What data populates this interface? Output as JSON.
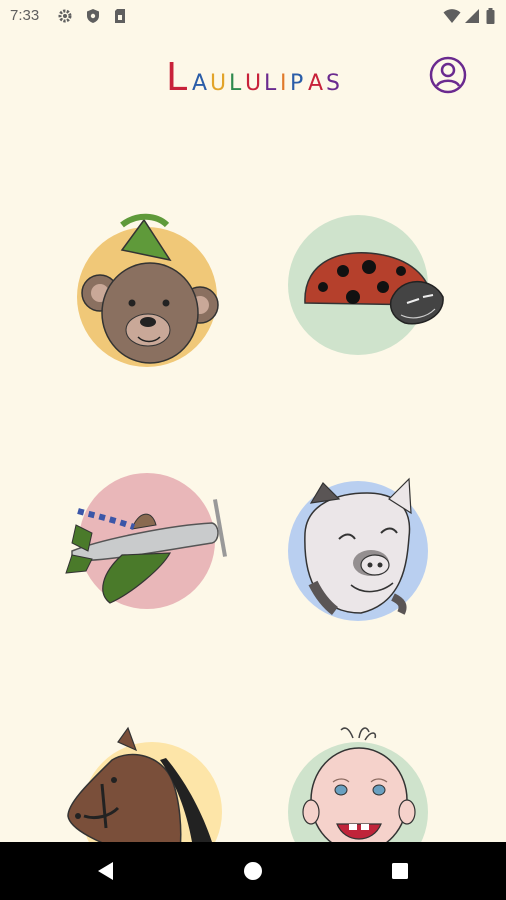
{
  "status_bar": {
    "time": "7:33",
    "left_icons": [
      "gear-icon",
      "shield-icon",
      "sim-card-icon"
    ],
    "right_icons": [
      "wifi-icon",
      "cellular-signal-icon",
      "battery-icon"
    ]
  },
  "app_bar": {
    "logo_letters": [
      "L",
      "A",
      "U",
      "L",
      "U",
      "L",
      "I",
      "P",
      "A",
      "S"
    ],
    "profile_icon": "account-circle-icon",
    "accent_color": "#6a2a8f"
  },
  "song_tiles": [
    {
      "icon": "teddy-bear-party-hat",
      "circle_color": "#f0c878"
    },
    {
      "icon": "ladybug",
      "circle_color": "#cfe3cc"
    },
    {
      "icon": "airplane-with-pilot",
      "circle_color": "#e9b7b9"
    },
    {
      "icon": "pig",
      "circle_color": "#b9cff0"
    },
    {
      "icon": "horse",
      "circle_color": "#fde5a8"
    },
    {
      "icon": "baby",
      "circle_color": "#cfe3cc"
    }
  ],
  "nav_bar": {
    "buttons": [
      "back-icon",
      "home-icon",
      "recents-icon"
    ]
  }
}
